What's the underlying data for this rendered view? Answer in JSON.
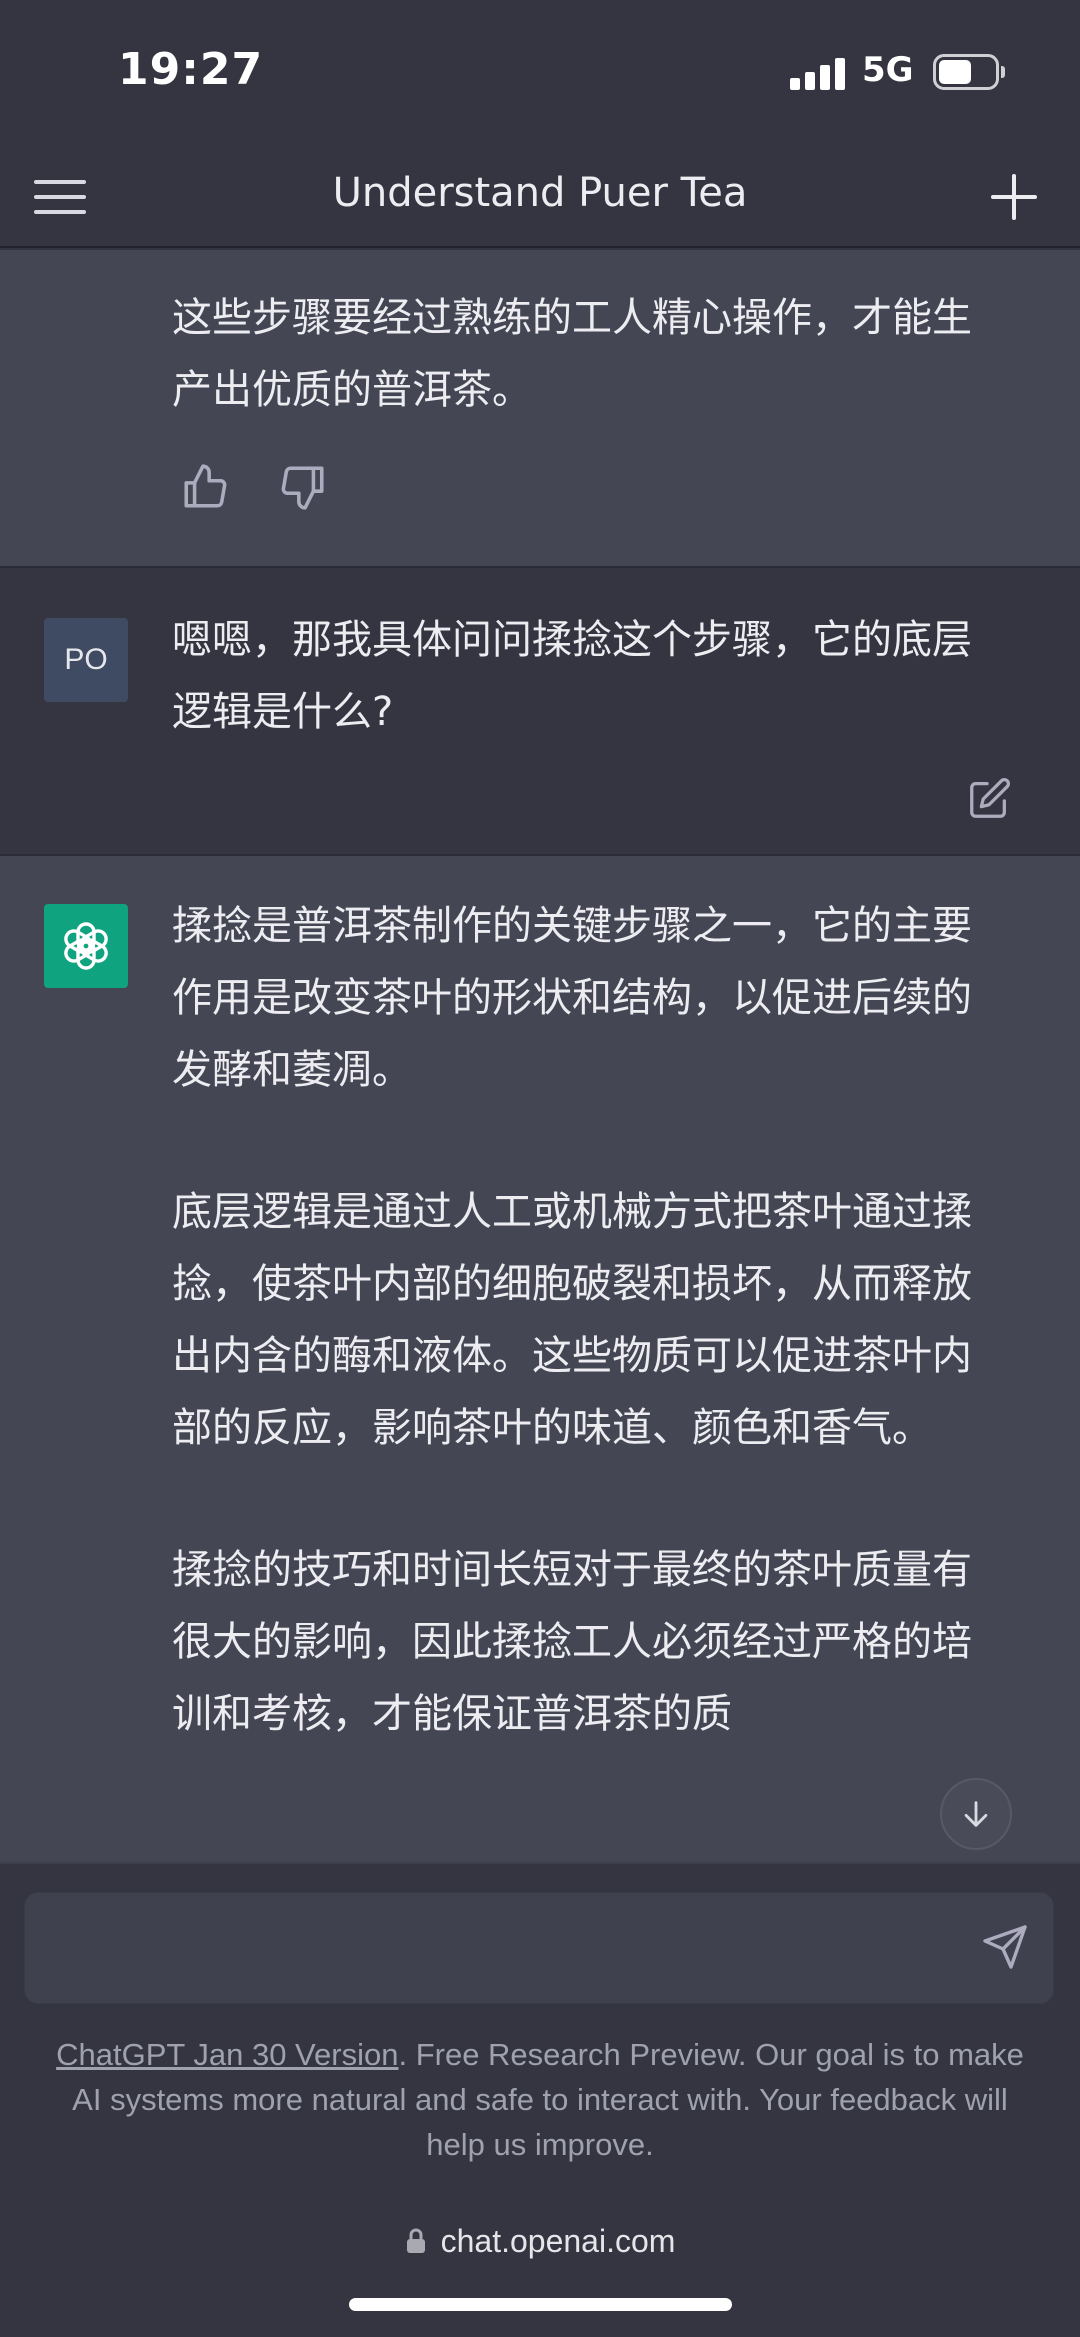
{
  "status_bar": {
    "time": "19:27",
    "network": "5G",
    "battery_level": 0.6
  },
  "header": {
    "title": "Understand Puer Tea",
    "menu_icon": "hamburger-menu-icon",
    "new_chat_icon": "plus-icon"
  },
  "conversation": {
    "previous_ai_tail": "这些步骤要经过熟练的工人精心操作，才能生产出优质的普洱茶。",
    "user_message": {
      "avatar": "PO",
      "text": "嗯嗯，那我具体问问揉捻这个步骤，它的底层逻辑是什么?"
    },
    "ai_response": {
      "paragraphs": [
        "揉捻是普洱茶制作的关键步骤之一，它的主要作用是改变茶叶的形状和结构，以促进后续的发酵和萎凋。",
        "底层逻辑是通过人工或机械方式把茶叶通过揉捻，使茶叶内部的细胞破裂和损坏，从而释放出内含的酶和液体。这些物质可以促进茶叶内部的反应，影响茶叶的味道、颜色和香气。",
        "揉捻的技巧和时间长短对于最终的茶叶质量有很大的影响，因此揉捻工人必须经过严格的培训和考核，才能保证普洱茶的质"
      ]
    }
  },
  "composer": {
    "placeholder": "",
    "send_icon": "send-icon"
  },
  "footer": {
    "version_link": "ChatGPT Jan 30 Version",
    "note": ". Free Research Preview. Our goal is to make AI systems more natural and safe to interact with. Your feedback will help us improve."
  },
  "browser": {
    "url": "chat.openai.com",
    "lock_icon": "lock-icon"
  },
  "colors": {
    "background": "#343541",
    "ai_message_bg": "#444654",
    "brand_green": "#10a37f",
    "input_bg": "#40414f"
  }
}
